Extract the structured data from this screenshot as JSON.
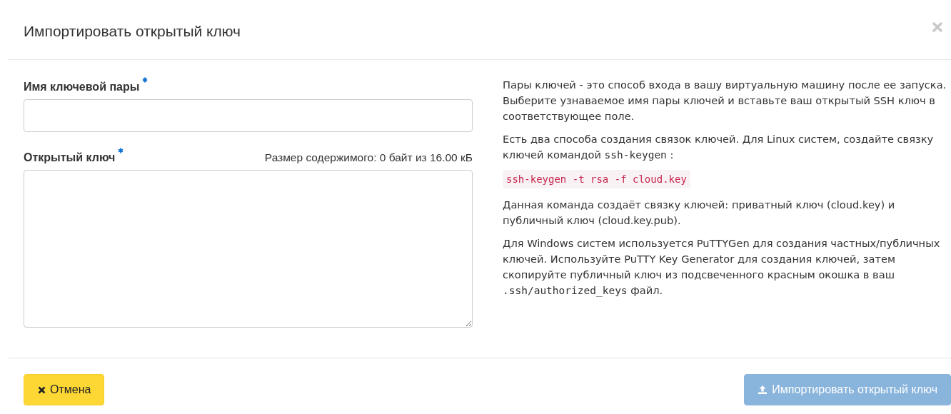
{
  "dialog": {
    "title": "Импортировать открытый ключ"
  },
  "fields": [
    {
      "kind": "input",
      "label": "Имя ключевой пары",
      "required": true
    },
    {
      "kind": "textarea",
      "label": "Открытый ключ",
      "required": true,
      "hint": "Размер содержимого: 0 байт из 16.00 кБ"
    }
  ],
  "help": [
    [
      {
        "kind": "text",
        "text": "Пары ключей - это способ входа в вашу виртуальную машину после ее запуска. Выберите узнаваемое имя пары ключей и вставьте ваш открытый SSH ключ в соответствующее поле."
      }
    ],
    [
      {
        "kind": "text",
        "text": "Есть два способа создания связок ключей. Для Linux систем, создайте связку ключей командой "
      },
      {
        "kind": "code",
        "text": "ssh-keygen"
      },
      {
        "kind": "text",
        "text": " :"
      }
    ],
    [
      {
        "kind": "block",
        "text": "ssh-keygen -t rsa -f cloud.key"
      }
    ],
    [
      {
        "kind": "text",
        "text": "Данная команда создаёт связку ключей: приватный ключ (cloud.key) и публичный ключ (cloud.key.pub)."
      }
    ],
    [
      {
        "kind": "text",
        "text": "Для Windows систем используется PuTTYGen для создания частных/публичных ключей. Используйте PuTTY Key Generator для создания ключей, затем скопируйте публичный ключ из подсвеченного красным окошка в ваш "
      },
      {
        "kind": "code",
        "text": ".ssh/authorized_keys"
      },
      {
        "kind": "text",
        "text": " файл."
      }
    ]
  ],
  "buttons": [
    {
      "kind": "cancel",
      "label": "Отмена",
      "disabled": false
    },
    {
      "kind": "submit",
      "label": "Импортировать открытый ключ",
      "disabled": true
    }
  ]
}
